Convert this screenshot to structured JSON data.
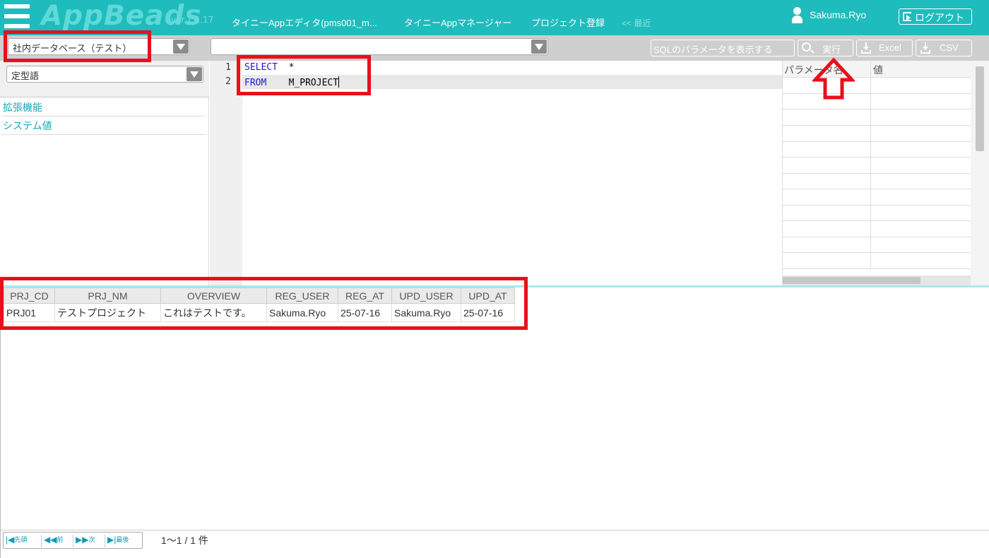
{
  "header": {
    "logo": "AppBeads",
    "version": "ver.1.1.17",
    "nav": [
      {
        "label": "タイニーAppエディタ(pms001_m..."
      },
      {
        "label": "タイニーAppマネージャー"
      },
      {
        "label": "プロジェクト登録"
      }
    ],
    "recent": "<< 最近",
    "user": "Sakuma.Ryo",
    "logout": "ログアウト"
  },
  "toolbar": {
    "database_select": "社内データベース（テスト）",
    "query_select": "",
    "show_params_button": "SQLのパラメータを表示する",
    "run_button": "実行",
    "excel_button": "Excel",
    "csv_button": "CSV"
  },
  "left_panel": {
    "phrase_select": "定型語",
    "links": [
      {
        "label": "拡張機能"
      },
      {
        "label": "システム値"
      }
    ]
  },
  "editor": {
    "lines": [
      {
        "num": "1",
        "keyword": "SELECT",
        "rest": "  *"
      },
      {
        "num": "2",
        "keyword": "FROM",
        "rest": "    M_PROJECT"
      }
    ]
  },
  "params_table": {
    "headers": [
      "パラメータ名",
      "値"
    ]
  },
  "results": {
    "columns": [
      "PRJ_CD",
      "PRJ_NM",
      "OVERVIEW",
      "REG_USER",
      "REG_AT",
      "UPD_USER",
      "UPD_AT"
    ],
    "rows": [
      [
        "PRJ01",
        "テストプロジェクト",
        "これはテストです。",
        "Sakuma.Ryo",
        "25-07-16",
        "Sakuma.Ryo",
        "25-07-16"
      ]
    ]
  },
  "pager": {
    "first": "先頭",
    "prev": "前",
    "next": "次",
    "last": "最後",
    "info": "1～1 / 1 件"
  },
  "colors": {
    "header_bg": "#1ebcbc",
    "keyword": "#1a1ad0",
    "annotation": "#e8101a"
  }
}
